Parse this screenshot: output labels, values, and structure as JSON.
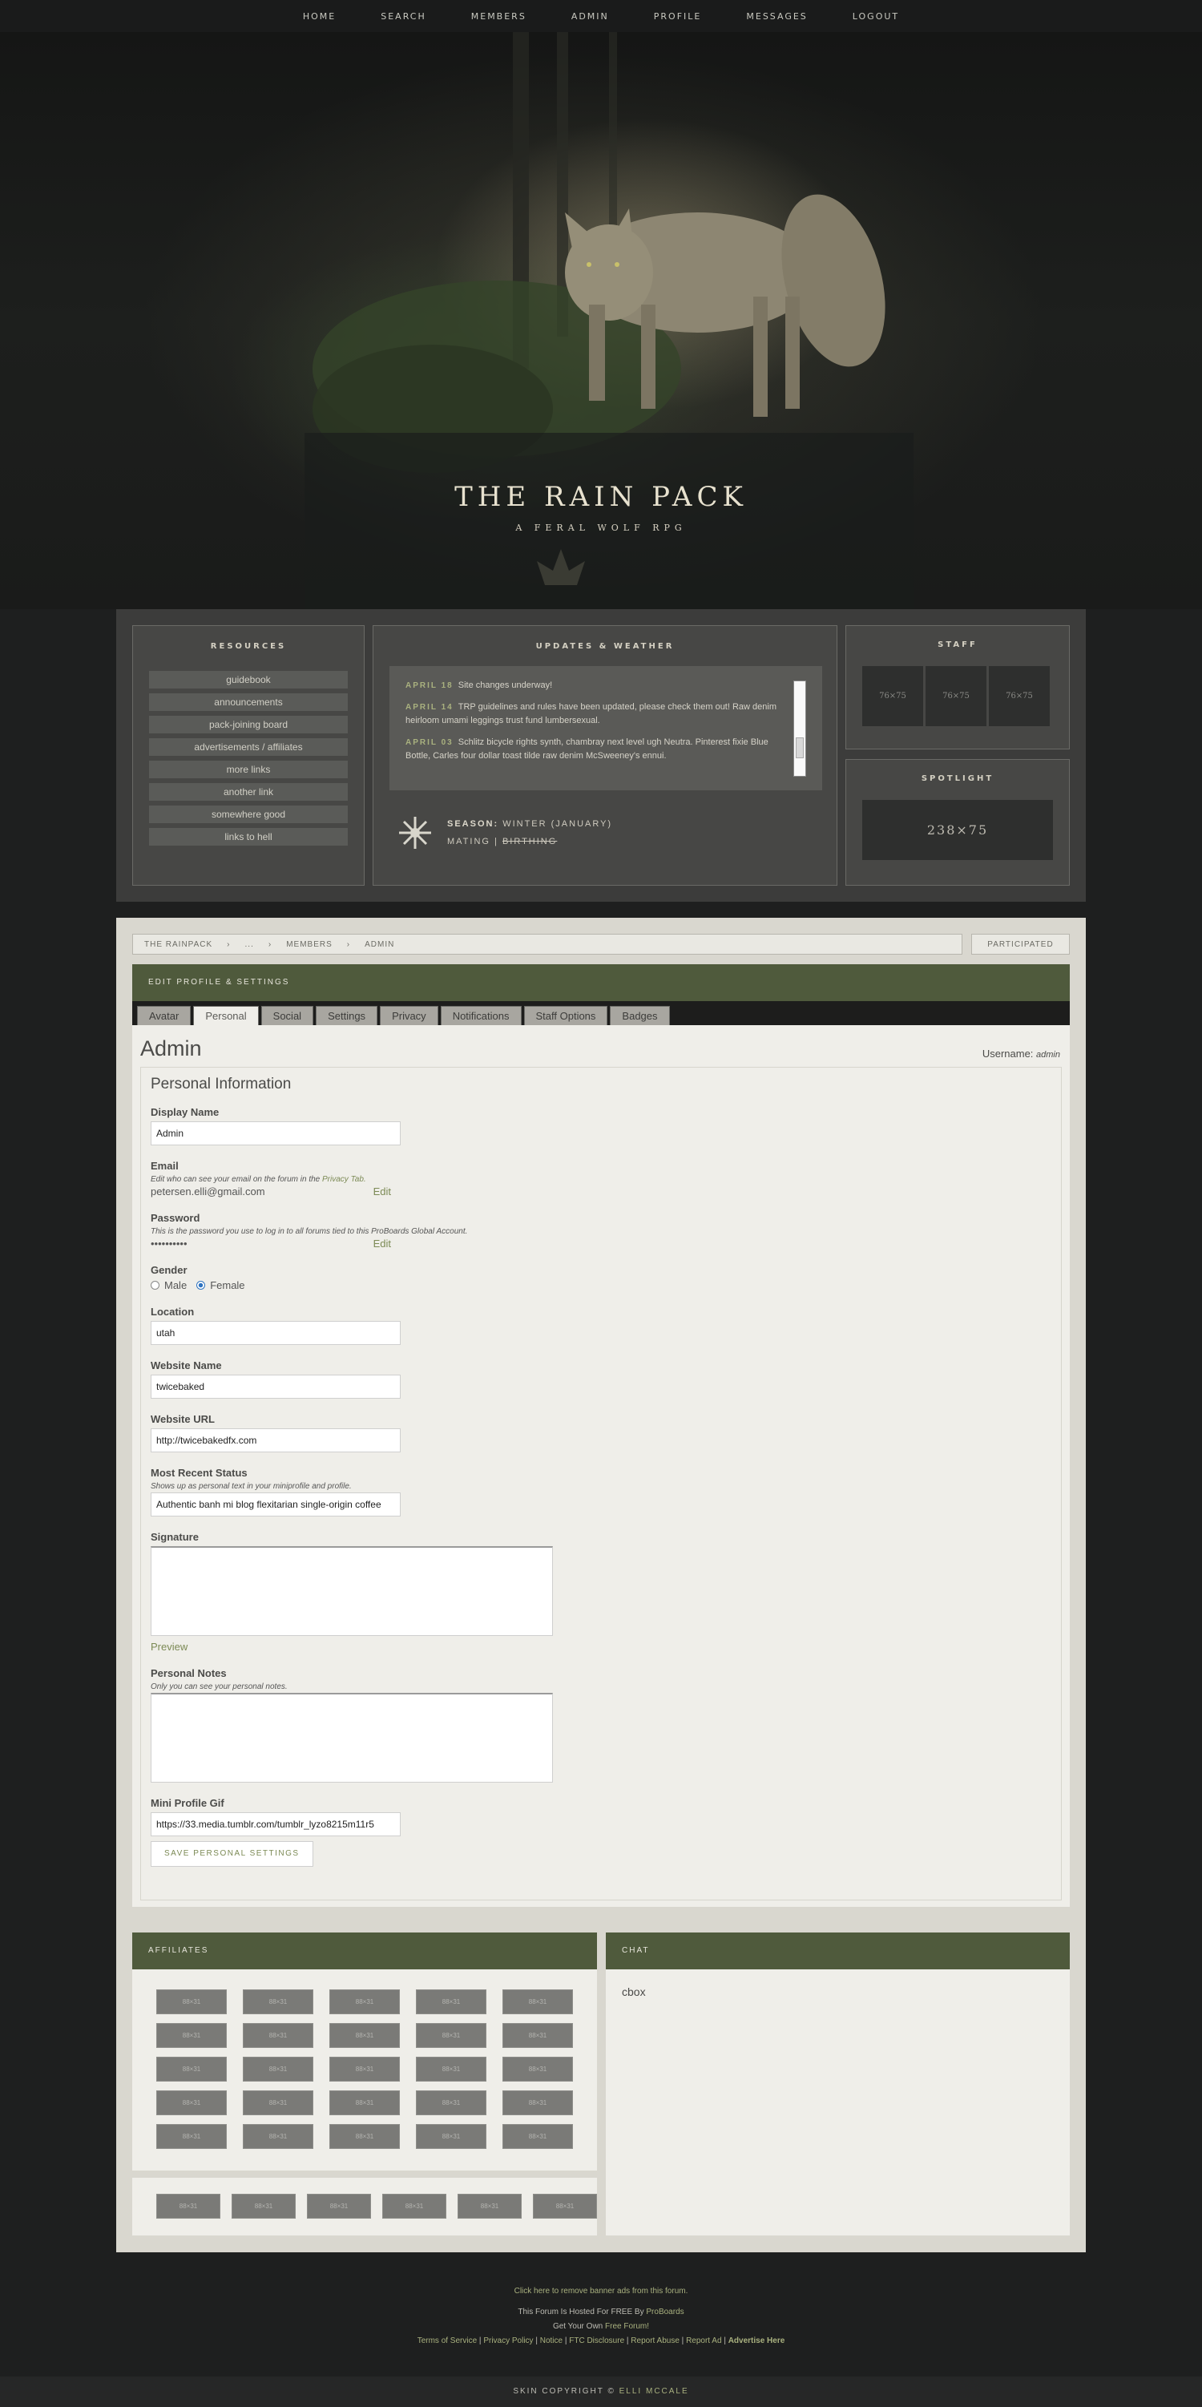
{
  "nav": [
    "HOME",
    "SEARCH",
    "MEMBERS",
    "ADMIN",
    "PROFILE",
    "MESSAGES",
    "LOGOUT"
  ],
  "hero": {
    "title": "THE RAIN PACK",
    "subtitle": "A FERAL WOLF RPG"
  },
  "resources": {
    "title": "RESOURCES",
    "links": [
      "guidebook",
      "announcements",
      "pack-joining board",
      "advertisements / affiliates",
      "more links",
      "another link",
      "somewhere good",
      "links to hell"
    ]
  },
  "updates": {
    "title": "UPDATES & WEATHER",
    "items": [
      {
        "date": "APRIL 18",
        "text": "Site changes underway!"
      },
      {
        "date": "APRIL 14",
        "text": "TRP guidelines and rules have been updated, please check them out! Raw denim heirloom umami leggings trust fund lumbersexual."
      },
      {
        "date": "APRIL 03",
        "text": "Schlitz bicycle rights synth, chambray next level ugh Neutra. Pinterest fixie Blue Bottle, Carles four dollar toast tilde raw denim McSweeney's ennui."
      }
    ],
    "season_label": "SEASON:",
    "season_value": "WINTER (JANUARY)",
    "mating": "MATING",
    "separator": "|",
    "birthing": "BIRTHING"
  },
  "staff": {
    "title": "STAFF",
    "avatars": [
      "76×75",
      "76×75",
      "76×75"
    ]
  },
  "spotlight": {
    "title": "SPOTLIGHT",
    "image": "238×75"
  },
  "breadcrumb": [
    "THE RAINPACK",
    "›",
    "...",
    "›",
    "MEMBERS",
    "›",
    "ADMIN"
  ],
  "participated": "PARTICIPATED",
  "edit_header": "EDIT PROFILE & SETTINGS",
  "tabs": [
    {
      "label": "Avatar"
    },
    {
      "label": "Personal",
      "active": true
    },
    {
      "label": "Social"
    },
    {
      "label": "Settings"
    },
    {
      "label": "Privacy"
    },
    {
      "label": "Notifications"
    },
    {
      "label": "Staff Options"
    },
    {
      "label": "Badges"
    }
  ],
  "profile": {
    "title": "Admin",
    "username_label": "Username:",
    "username": "admin",
    "section_title": "Personal Information",
    "display_name_label": "Display Name",
    "display_name": "Admin",
    "email_label": "Email",
    "email_desc": "Edit who can see your email on the forum in the",
    "email_desc_link": "Privacy Tab.",
    "email": "petersen.elli@gmail.com",
    "edit": "Edit",
    "password_label": "Password",
    "password_desc": "This is the password you use to log in to all forums tied to this ProBoards Global Account.",
    "password": "••••••••••",
    "gender_label": "Gender",
    "male": "Male",
    "female": "Female",
    "location_label": "Location",
    "location": "utah",
    "website_name_label": "Website Name",
    "website_name": "twicebaked",
    "website_url_label": "Website URL",
    "website_url": "http://twicebakedfx.com",
    "status_label": "Most Recent Status",
    "status_desc": "Shows up as personal text in your miniprofile and profile.",
    "status": "Authentic banh mi blog flexitarian single-origin coffee",
    "signature_label": "Signature",
    "preview": "Preview",
    "notes_label": "Personal Notes",
    "notes_desc": "Only you can see your personal notes.",
    "gif_label": "Mini Profile Gif",
    "gif": "https://33.media.tumblr.com/tumblr_lyzo8215m11r5",
    "save": "SAVE PERSONAL SETTINGS"
  },
  "affiliates": {
    "title": "AFFILIATES",
    "button_label": "88×31",
    "grid_count": 25,
    "row2_count": 6
  },
  "chat": {
    "title": "CHAT",
    "content": "cbox"
  },
  "footer": {
    "remove_ads": "Click here to remove banner ads from this forum.",
    "hosted_prefix": "This Forum Is Hosted For FREE By",
    "hosted_link": "ProBoards",
    "own_prefix": "Get Your Own",
    "own_link": "Free Forum!",
    "links": [
      "Terms of Service",
      "Privacy Policy",
      "Notice",
      "FTC Disclosure",
      "Report Abuse",
      "Report Ad"
    ],
    "advertise": "Advertise Here",
    "copyright_prefix": "SKIN COPYRIGHT ©",
    "copyright_name": "ELLI MCCALE"
  }
}
